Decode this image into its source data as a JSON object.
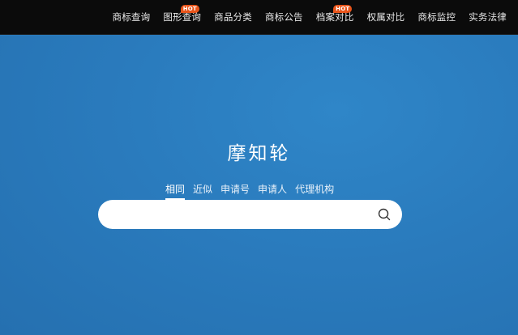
{
  "nav": {
    "items": [
      {
        "label": "商标查询",
        "badge": ""
      },
      {
        "label": "图形查询",
        "badge": "HOT"
      },
      {
        "label": "商品分类",
        "badge": ""
      },
      {
        "label": "商标公告",
        "badge": ""
      },
      {
        "label": "档案对比",
        "badge": "HOT"
      },
      {
        "label": "权属对比",
        "badge": ""
      },
      {
        "label": "商标监控",
        "badge": ""
      },
      {
        "label": "实务法律",
        "badge": ""
      }
    ]
  },
  "brand": {
    "title": "摩知轮"
  },
  "search": {
    "tabs": [
      "相同",
      "近似",
      "申请号",
      "申请人",
      "代理机构"
    ],
    "active_tab": "相同",
    "value": "",
    "placeholder": ""
  },
  "colors": {
    "topbar": "#0b0b0b",
    "hero": "#2a7bbd",
    "badge": "#e8541a"
  }
}
